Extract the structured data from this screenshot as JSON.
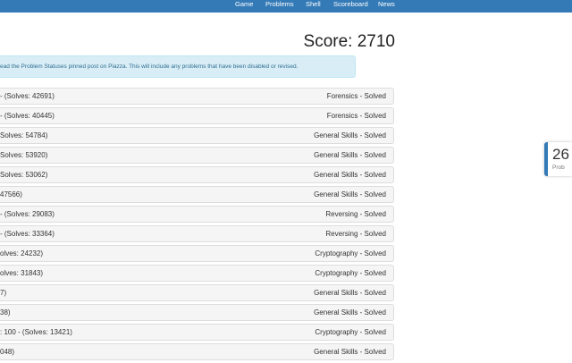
{
  "nav": {
    "items": [
      {
        "label": "Game"
      },
      {
        "label": "Problems"
      },
      {
        "label": "Shell"
      },
      {
        "label": "Scoreboard"
      },
      {
        "label": "News"
      }
    ],
    "color": "#337ab7"
  },
  "score": {
    "text": "Score: 2710"
  },
  "notice": {
    "before": "ead the Problem Statuses pinned post on ",
    "link": "Piazza",
    "after": ". This will include any problems that have been disabled or revised."
  },
  "problems": [
    {
      "left": "- (Solves: 42691)",
      "right": "Forensics - Solved"
    },
    {
      "left": "- (Solves: 40445)",
      "right": "Forensics - Solved"
    },
    {
      "left": "Solves: 54784)",
      "right": "General Skills - Solved"
    },
    {
      "left": "Solves: 53920)",
      "right": "General Skills - Solved"
    },
    {
      "left": "Solves: 53062)",
      "right": "General Skills - Solved"
    },
    {
      "left": "47566)",
      "right": "General Skills - Solved"
    },
    {
      "left": "- (Solves: 29083)",
      "right": "Reversing - Solved"
    },
    {
      "left": "- (Solves: 33364)",
      "right": "Reversing - Solved"
    },
    {
      "left": "olves: 24232)",
      "right": "Cryptography - Solved"
    },
    {
      "left": "olves: 31843)",
      "right": "Cryptography - Solved"
    },
    {
      "left": "7)",
      "right": "General Skills - Solved"
    },
    {
      "left": "38)",
      "right": "General Skills - Solved"
    },
    {
      "left": ": 100 - (Solves: 13421)",
      "right": "Cryptography - Solved"
    },
    {
      "left": "048)",
      "right": "General Skills - Solved"
    }
  ],
  "side_widget": {
    "number": "26",
    "label": "Prob"
  }
}
